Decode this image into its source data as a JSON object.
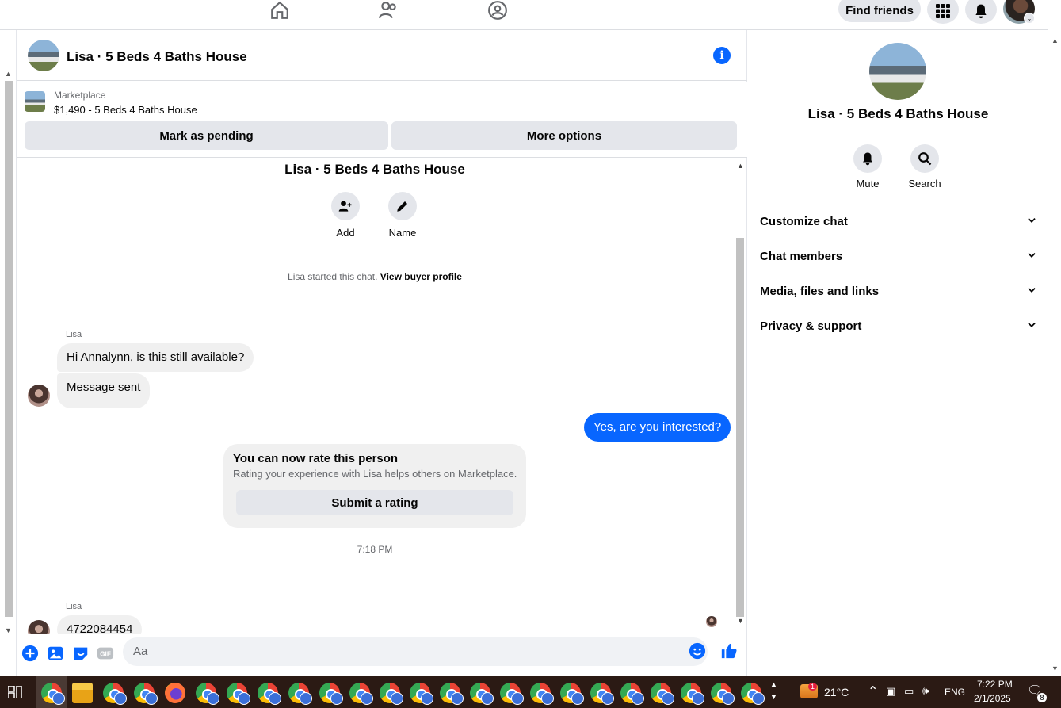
{
  "topnav": {
    "find_friends_label": "Find friends"
  },
  "chat": {
    "header_title": "Lisa · 5 Beds 4 Baths House",
    "listing": {
      "source": "Marketplace",
      "price_title": "$1,490 - 5 Beds 4 Baths House",
      "mark_pending_label": "Mark as pending",
      "more_options_label": "More options"
    },
    "convo_title": "Lisa · 5 Beds 4 Baths House",
    "actions": {
      "add_label": "Add",
      "name_label": "Name"
    },
    "system_text": "Lisa started this chat.",
    "system_link": "View buyer profile",
    "messages": [
      {
        "sender": "Lisa",
        "text": "Hi Annalynn, is this still available?",
        "direction": "in"
      },
      {
        "sender": "",
        "text": "Message sent",
        "direction": "in"
      },
      {
        "sender": "",
        "text": "Yes, are you interested?",
        "direction": "out"
      }
    ],
    "rating_card": {
      "heading": "You can now rate this person",
      "subtext": "Rating your experience with Lisa helps others on Marketplace.",
      "button_label": "Submit a rating"
    },
    "time_separator": "7:18 PM",
    "last_message": {
      "sender": "Lisa",
      "text": "4722084454"
    },
    "composer": {
      "placeholder": "Aa"
    }
  },
  "right_panel": {
    "title": "Lisa · 5 Beds 4 Baths House",
    "mute_label": "Mute",
    "search_label": "Search",
    "sections": [
      "Customize chat",
      "Chat members",
      "Media, files and links",
      "Privacy & support"
    ]
  },
  "taskbar": {
    "weather_alert_count": "1",
    "temperature": "21°C",
    "language": "ENG",
    "time": "7:22 PM",
    "date": "2/1/2025",
    "notification_count": "8"
  },
  "colors": {
    "accent": "#0866ff",
    "bubble_in": "#f0f0f0",
    "button_gray": "#e4e6eb",
    "taskbar": "#2b1a14"
  }
}
